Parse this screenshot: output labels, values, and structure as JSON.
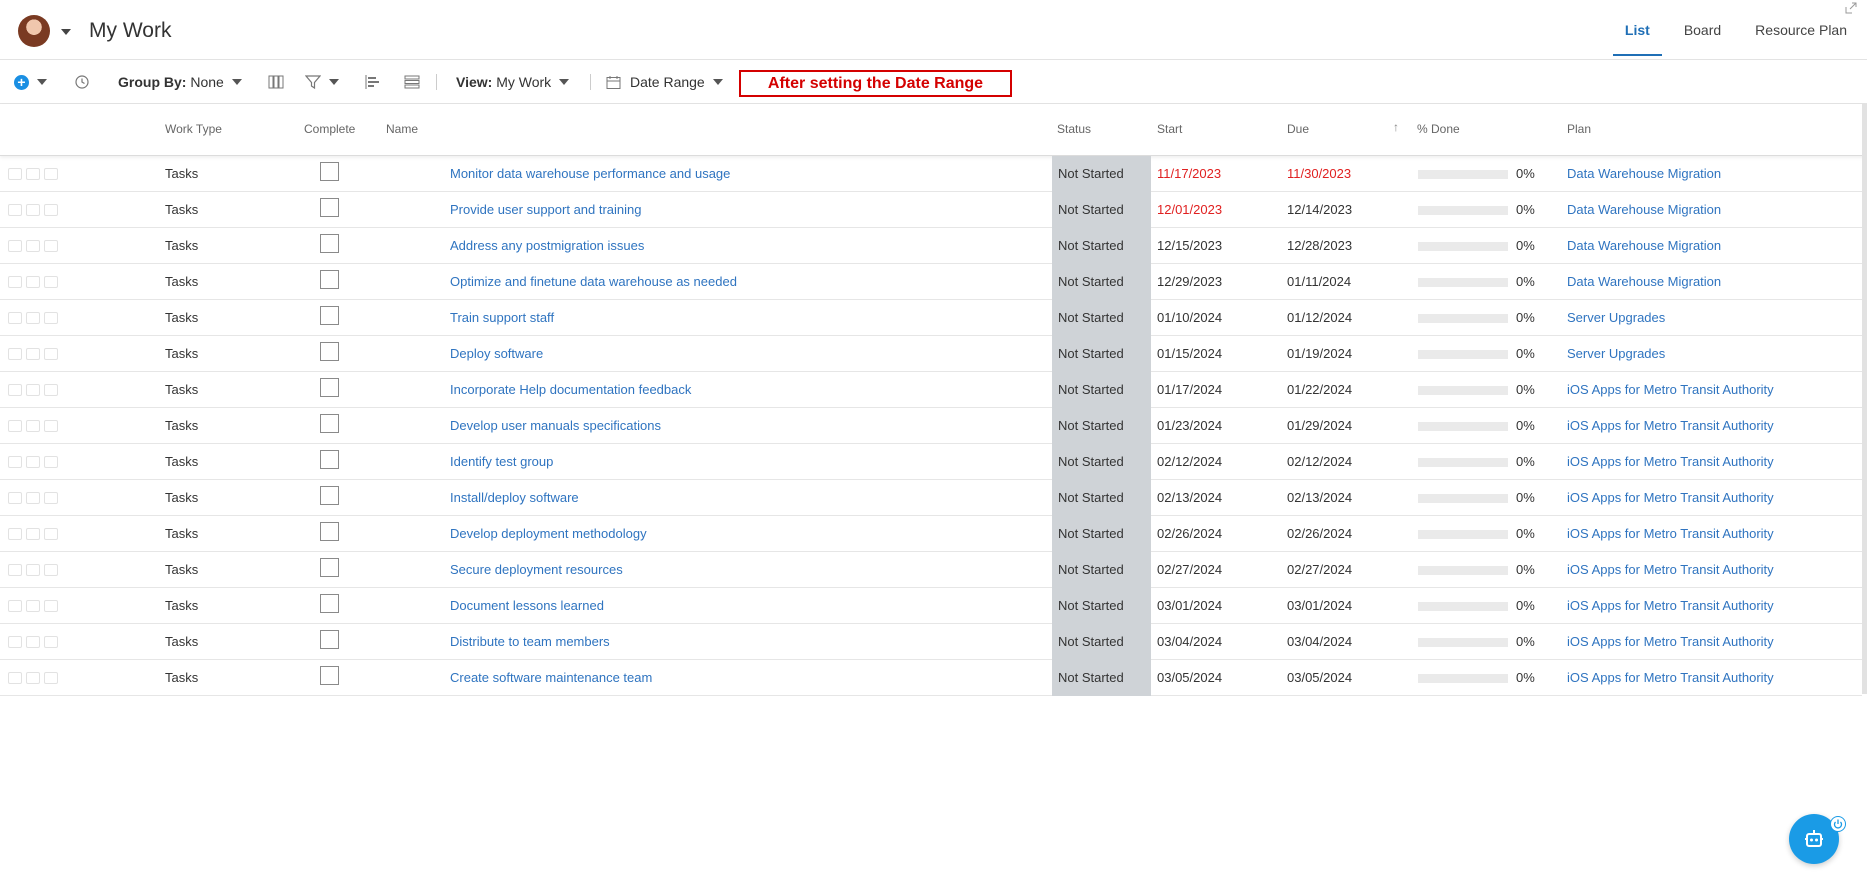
{
  "header": {
    "title": "My Work",
    "tabs": [
      {
        "label": "List",
        "active": true
      },
      {
        "label": "Board",
        "active": false
      },
      {
        "label": "Resource Plan",
        "active": false
      }
    ]
  },
  "toolbar": {
    "group_by_label": "Group By:",
    "group_by_value": "None",
    "view_label": "View:",
    "view_value": "My Work",
    "date_range": "Date Range",
    "annotation": "After setting the Date Range"
  },
  "columns": {
    "work_type": "Work Type",
    "complete": "Complete",
    "name": "Name",
    "status": "Status",
    "start": "Start",
    "due": "Due",
    "percent_done": "% Done",
    "plan": "Plan"
  },
  "rows": [
    {
      "type": "Tasks",
      "name": "Monitor data warehouse performance and usage",
      "status": "Not Started",
      "start": "11/17/2023",
      "due": "11/30/2023",
      "pct": "0%",
      "plan": "Data Warehouse Migration",
      "start_overdue": true,
      "due_overdue": true
    },
    {
      "type": "Tasks",
      "name": "Provide user support and training",
      "status": "Not Started",
      "start": "12/01/2023",
      "due": "12/14/2023",
      "pct": "0%",
      "plan": "Data Warehouse Migration",
      "start_overdue": true,
      "due_overdue": false
    },
    {
      "type": "Tasks",
      "name": "Address any postmigration issues",
      "status": "Not Started",
      "start": "12/15/2023",
      "due": "12/28/2023",
      "pct": "0%",
      "plan": "Data Warehouse Migration",
      "start_overdue": false,
      "due_overdue": false
    },
    {
      "type": "Tasks",
      "name": "Optimize and finetune data warehouse as needed",
      "status": "Not Started",
      "start": "12/29/2023",
      "due": "01/11/2024",
      "pct": "0%",
      "plan": "Data Warehouse Migration",
      "start_overdue": false,
      "due_overdue": false
    },
    {
      "type": "Tasks",
      "name": "Train support staff",
      "status": "Not Started",
      "start": "01/10/2024",
      "due": "01/12/2024",
      "pct": "0%",
      "plan": "Server Upgrades",
      "start_overdue": false,
      "due_overdue": false
    },
    {
      "type": "Tasks",
      "name": "Deploy software",
      "status": "Not Started",
      "start": "01/15/2024",
      "due": "01/19/2024",
      "pct": "0%",
      "plan": "Server Upgrades",
      "start_overdue": false,
      "due_overdue": false
    },
    {
      "type": "Tasks",
      "name": "Incorporate Help documentation feedback",
      "status": "Not Started",
      "start": "01/17/2024",
      "due": "01/22/2024",
      "pct": "0%",
      "plan": "iOS Apps for Metro Transit Authority",
      "start_overdue": false,
      "due_overdue": false
    },
    {
      "type": "Tasks",
      "name": "Develop user manuals specifications",
      "status": "Not Started",
      "start": "01/23/2024",
      "due": "01/29/2024",
      "pct": "0%",
      "plan": "iOS Apps for Metro Transit Authority",
      "start_overdue": false,
      "due_overdue": false
    },
    {
      "type": "Tasks",
      "name": "Identify test group",
      "status": "Not Started",
      "start": "02/12/2024",
      "due": "02/12/2024",
      "pct": "0%",
      "plan": "iOS Apps for Metro Transit Authority",
      "start_overdue": false,
      "due_overdue": false
    },
    {
      "type": "Tasks",
      "name": "Install/deploy software",
      "status": "Not Started",
      "start": "02/13/2024",
      "due": "02/13/2024",
      "pct": "0%",
      "plan": "iOS Apps for Metro Transit Authority",
      "start_overdue": false,
      "due_overdue": false
    },
    {
      "type": "Tasks",
      "name": "Develop deployment methodology",
      "status": "Not Started",
      "start": "02/26/2024",
      "due": "02/26/2024",
      "pct": "0%",
      "plan": "iOS Apps for Metro Transit Authority",
      "start_overdue": false,
      "due_overdue": false
    },
    {
      "type": "Tasks",
      "name": "Secure deployment resources",
      "status": "Not Started",
      "start": "02/27/2024",
      "due": "02/27/2024",
      "pct": "0%",
      "plan": "iOS Apps for Metro Transit Authority",
      "start_overdue": false,
      "due_overdue": false
    },
    {
      "type": "Tasks",
      "name": "Document lessons learned",
      "status": "Not Started",
      "start": "03/01/2024",
      "due": "03/01/2024",
      "pct": "0%",
      "plan": "iOS Apps for Metro Transit Authority",
      "start_overdue": false,
      "due_overdue": false
    },
    {
      "type": "Tasks",
      "name": "Distribute to team members",
      "status": "Not Started",
      "start": "03/04/2024",
      "due": "03/04/2024",
      "pct": "0%",
      "plan": "iOS Apps for Metro Transit Authority",
      "start_overdue": false,
      "due_overdue": false
    },
    {
      "type": "Tasks",
      "name": "Create software maintenance team",
      "status": "Not Started",
      "start": "03/05/2024",
      "due": "03/05/2024",
      "pct": "0%",
      "plan": "iOS Apps for Metro Transit Authority",
      "start_overdue": false,
      "due_overdue": false
    }
  ],
  "colors": {
    "accent": "#1f6fb6",
    "link": "#2f74c0",
    "overdue": "#e02020",
    "status_bg": "#cfd3d7",
    "annotation": "#d40000"
  }
}
